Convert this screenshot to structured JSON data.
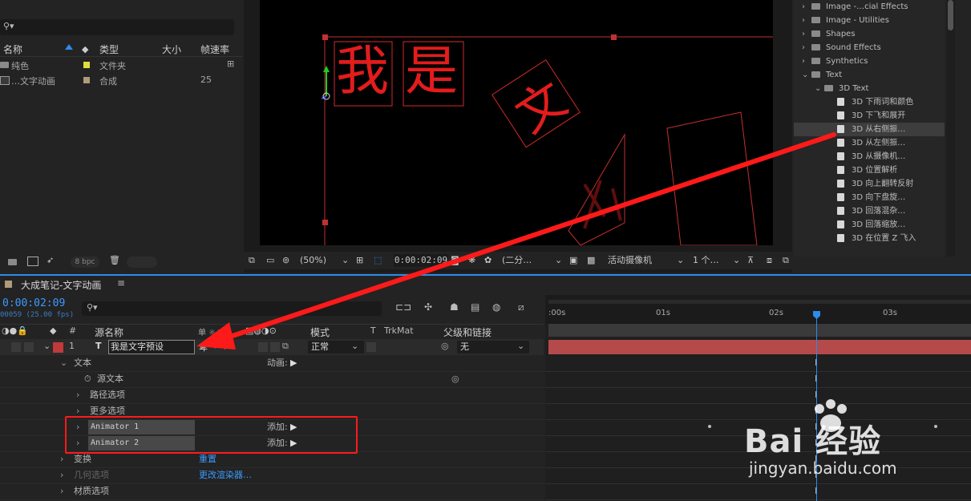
{
  "project": {
    "columns": {
      "name": "名称",
      "type": "类型",
      "size": "大小",
      "fps": "帧速率"
    },
    "rows": [
      {
        "name": "纯色",
        "type": "文件夹",
        "fps": ""
      },
      {
        "name": "…文字动画",
        "type": "合成",
        "fps": "25"
      }
    ],
    "bpc": "8 bpc"
  },
  "viewer": {
    "text_chars": [
      "我",
      "是"
    ],
    "zoom": "(50%)",
    "time": "0:00:02:09",
    "resolution": "(二分…",
    "camera": "活动摄像机",
    "views": "1 个…"
  },
  "effects": {
    "items": [
      {
        "label": "Image -…cial Effects",
        "kind": "folder",
        "indent": 0,
        "open": false
      },
      {
        "label": "Image - Utilities",
        "kind": "folder",
        "indent": 0,
        "open": false
      },
      {
        "label": "Shapes",
        "kind": "folder",
        "indent": 0,
        "open": false
      },
      {
        "label": "Sound Effects",
        "kind": "folder",
        "indent": 0,
        "open": false
      },
      {
        "label": "Synthetics",
        "kind": "folder",
        "indent": 0,
        "open": false
      },
      {
        "label": "Text",
        "kind": "folder",
        "indent": 0,
        "open": true
      },
      {
        "label": "3D Text",
        "kind": "folder",
        "indent": 1,
        "open": true
      },
      {
        "label": "3D 下雨词和颜色",
        "kind": "preset",
        "indent": 2
      },
      {
        "label": "3D 下飞和展开",
        "kind": "preset",
        "indent": 2
      },
      {
        "label": "3D 从右侧振…",
        "kind": "preset",
        "indent": 2,
        "selected": true
      },
      {
        "label": "3D 从左侧振…",
        "kind": "preset",
        "indent": 2
      },
      {
        "label": "3D 从摄像机…",
        "kind": "preset",
        "indent": 2
      },
      {
        "label": "3D 位置解析",
        "kind": "preset",
        "indent": 2
      },
      {
        "label": "3D 向上翻转反射",
        "kind": "preset",
        "indent": 2
      },
      {
        "label": "3D 向下盘旋…",
        "kind": "preset",
        "indent": 2
      },
      {
        "label": "3D 回落混杂…",
        "kind": "preset",
        "indent": 2
      },
      {
        "label": "3D 回落缩放…",
        "kind": "preset",
        "indent": 2
      },
      {
        "label": "3D 在位置 Z 飞入",
        "kind": "preset",
        "indent": 2
      }
    ]
  },
  "timeline": {
    "comp_name": "大成笔记-文字动画",
    "timecode": "0:00:02:09",
    "frames": "00059 (25.00 fps)",
    "headers": {
      "num": "#",
      "source": "源名称",
      "switches": "单 ☼ \\ fx",
      "mode": "模式",
      "t": "T",
      "trkmat": "TrkMat",
      "parent": "父级和链接"
    },
    "layer": {
      "index": "1",
      "type": "T",
      "name": "我是文字预设",
      "mode": "正常",
      "parent": "无"
    },
    "props": [
      {
        "label": "文本",
        "indent": 1,
        "twirl": "open",
        "extra": "动画:"
      },
      {
        "label": "源文本",
        "indent": 2,
        "twirl": "none"
      },
      {
        "label": "路径选项",
        "indent": 2,
        "twirl": "closed"
      },
      {
        "label": "更多选项",
        "indent": 2,
        "twirl": "closed"
      },
      {
        "label": "Animator 1",
        "indent": 2,
        "twirl": "closed",
        "extra": "添加:",
        "boxed": true
      },
      {
        "label": "Animator 2",
        "indent": 2,
        "twirl": "closed",
        "extra": "添加:",
        "boxed": true
      },
      {
        "label": "变换",
        "indent": 1,
        "twirl": "closed",
        "link": "重置"
      },
      {
        "label": "几何选项",
        "indent": 1,
        "twirl": "closed",
        "link": "更改渲染器…",
        "dim": true
      },
      {
        "label": "材质选项",
        "indent": 1,
        "twirl": "closed"
      }
    ],
    "ruler": [
      ":00s",
      "01s",
      "02s",
      "03s"
    ]
  },
  "watermark": {
    "brand": "Bai 经验",
    "url": "jingyan.baidu.com"
  },
  "colors": {
    "accent": "#2d8ceb",
    "annotation": "#ff1a1a",
    "layer_bar": "#b54a4a"
  }
}
